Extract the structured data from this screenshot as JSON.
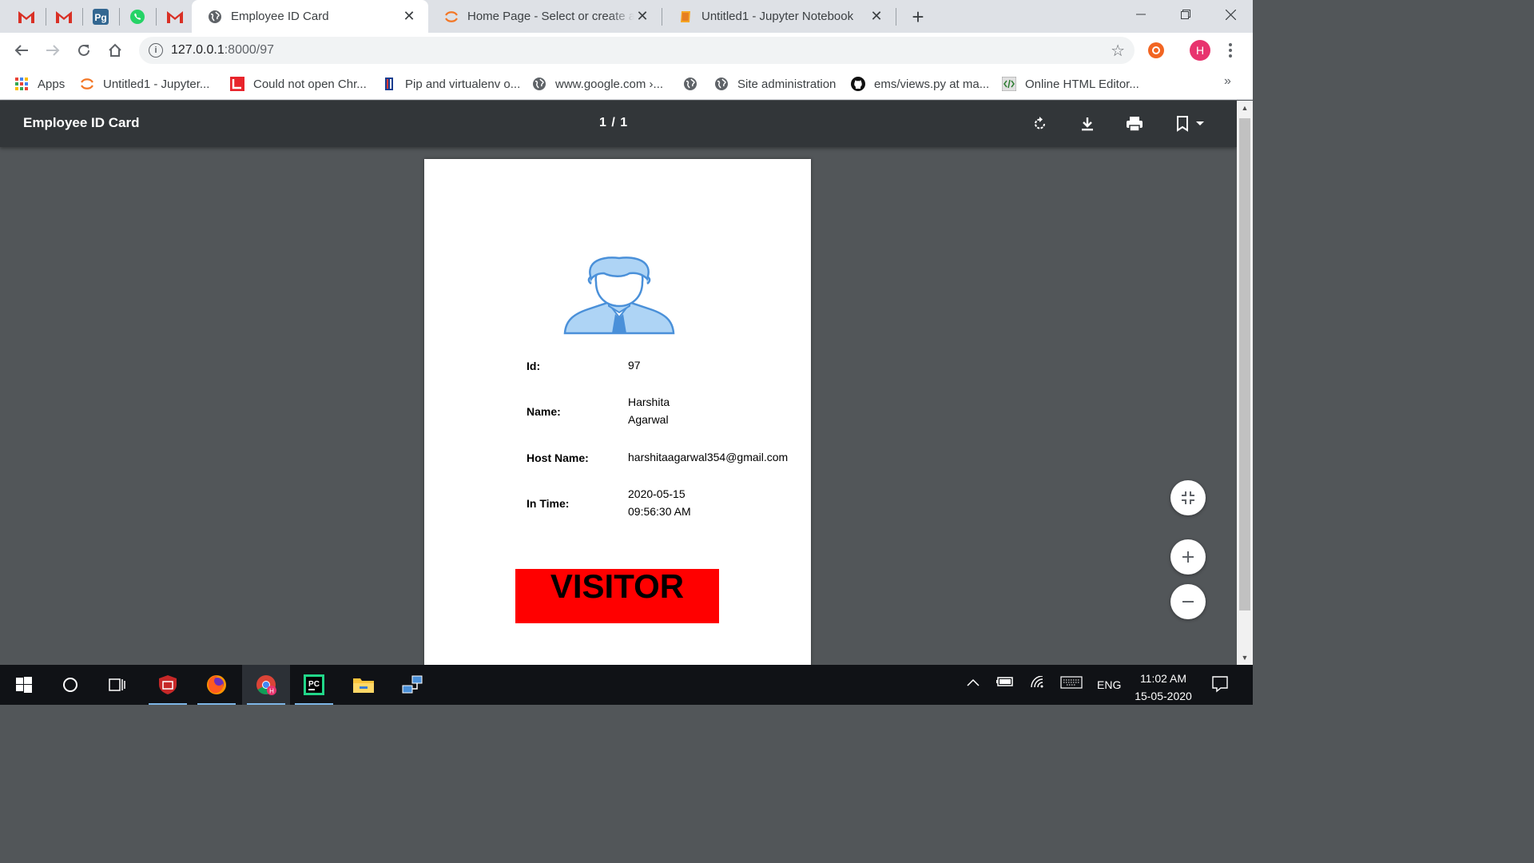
{
  "browser": {
    "tabs": [
      {
        "title": "Employee ID Card",
        "active": true
      },
      {
        "title": "Home Page - Select or create a n",
        "active": false
      },
      {
        "title": "Untitled1 - Jupyter Notebook",
        "active": false
      }
    ],
    "address": {
      "host": "127.0.0.1",
      "path": ":8000/97"
    },
    "profile_initial": "H",
    "bookmarks": [
      {
        "label": "Apps",
        "icon": "apps-grid-icon"
      },
      {
        "label": "Untitled1 - Jupyter...",
        "icon": "jupyter-icon"
      },
      {
        "label": "Could not open Chr...",
        "icon": "bookmark-red-icon"
      },
      {
        "label": "Pip and virtualenv o...",
        "icon": "python-icon"
      },
      {
        "label": "www.google.com ›...",
        "icon": "globe-icon"
      },
      {
        "label": "",
        "icon": "globe-icon"
      },
      {
        "label": "Site administration",
        "icon": "globe-icon"
      },
      {
        "label": "ems/views.py at ma...",
        "icon": "github-icon"
      },
      {
        "label": "Online HTML Editor...",
        "icon": "html-editor-icon"
      }
    ],
    "more_bookmarks": "»"
  },
  "pdf": {
    "title": "Employee ID Card",
    "pages": "1 / 1"
  },
  "card": {
    "id_label": "Id:",
    "id_value": "97",
    "name_label": "Name:",
    "name_value_line1": "Harshita",
    "name_value_line2": "Agarwal",
    "host_label": "Host Name:",
    "host_value": "harshitaagarwal354@gmail.com",
    "time_label": "In Time:",
    "time_value_line1": "2020-05-15",
    "time_value_line2": "09:56:30 AM",
    "badge": "VISITOR"
  },
  "taskbar": {
    "language": "ENG",
    "time": "11:02 AM",
    "date": "15-05-2020"
  },
  "colors": {
    "badge_bg": "#ff0000",
    "avatar_blue": "#4a90d9",
    "avatar_light": "#aed4f5"
  }
}
